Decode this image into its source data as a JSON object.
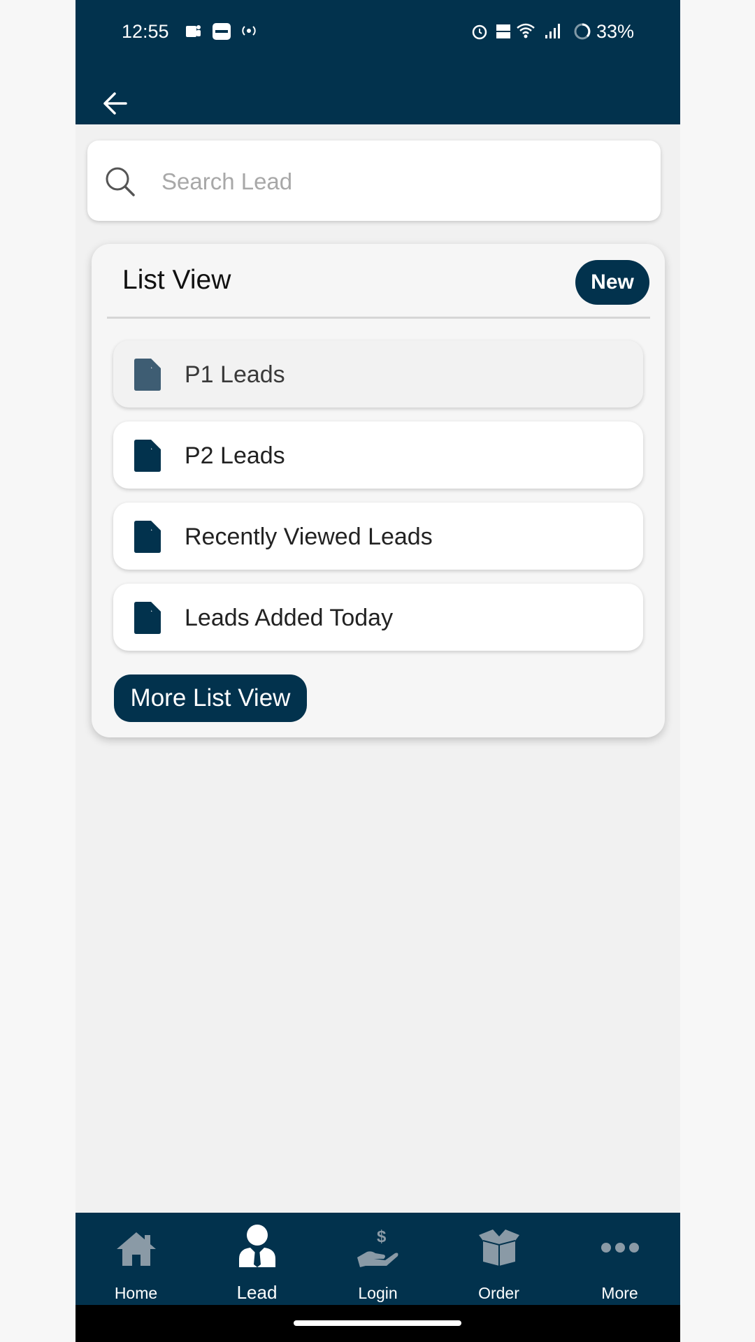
{
  "status_bar": {
    "time": "12:55",
    "battery": "33%"
  },
  "search": {
    "placeholder": "Search Lead"
  },
  "list_view": {
    "title": "List View",
    "new_label": "New",
    "items": [
      {
        "label": "P1 Leads"
      },
      {
        "label": "P2 Leads"
      },
      {
        "label": "Recently Viewed Leads"
      },
      {
        "label": "Leads Added Today"
      }
    ],
    "more_label": "More List View"
  },
  "bottom_nav": {
    "items": [
      {
        "label": "Home",
        "icon": "home-icon"
      },
      {
        "label": "Lead",
        "icon": "user-tie-icon"
      },
      {
        "label": "Login",
        "icon": "hand-dollar-icon"
      },
      {
        "label": "Order",
        "icon": "box-icon"
      },
      {
        "label": "More",
        "icon": "ellipsis-icon"
      }
    ]
  },
  "colors": {
    "primary": "#02324d",
    "background": "#f1f1f1"
  }
}
